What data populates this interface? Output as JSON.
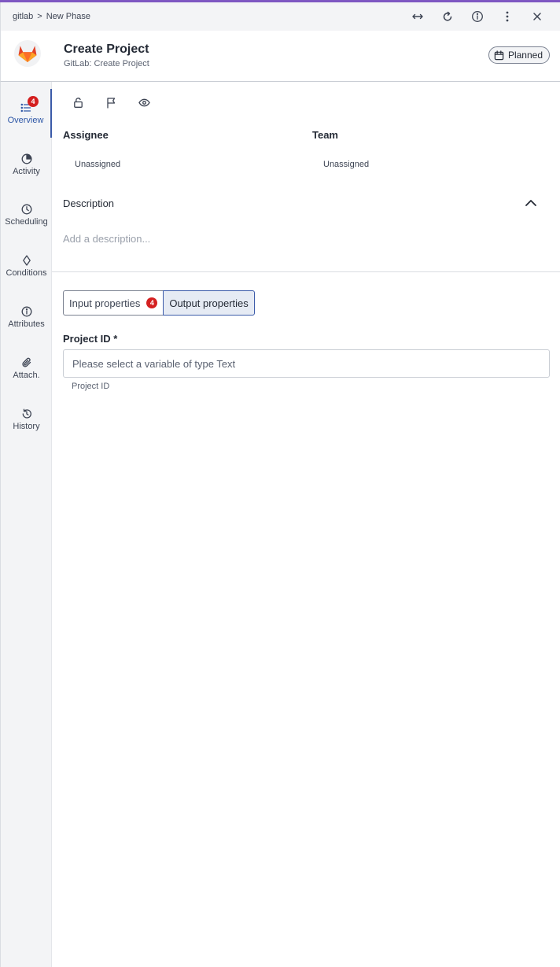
{
  "breadcrumb": {
    "root": "gitlab",
    "separator": ">",
    "current": "New Phase"
  },
  "topbar_icons": [
    "expand-horizontal-icon",
    "refresh-icon",
    "info-icon",
    "more-vertical-icon",
    "close-icon"
  ],
  "header": {
    "title": "Create Project",
    "subtitle": "GitLab: Create Project",
    "status": "Planned"
  },
  "sidebar": {
    "items": [
      {
        "label": "Overview",
        "icon": "list-icon",
        "badge": "4",
        "active": true
      },
      {
        "label": "Activity",
        "icon": "activity-pie-icon"
      },
      {
        "label": "Scheduling",
        "icon": "clock-icon"
      },
      {
        "label": "Conditions",
        "icon": "diamond-icon"
      },
      {
        "label": "Attributes",
        "icon": "info-icon"
      },
      {
        "label": "Attach.",
        "icon": "paperclip-icon"
      },
      {
        "label": "History",
        "icon": "history-icon"
      }
    ]
  },
  "toolbar_icons": [
    "unlock-icon",
    "flag-icon",
    "eye-icon"
  ],
  "assignee": {
    "label": "Assignee",
    "value": "Unassigned"
  },
  "team": {
    "label": "Team",
    "value": "Unassigned"
  },
  "description": {
    "label": "Description",
    "placeholder": "Add a description..."
  },
  "tabs": {
    "input": {
      "label": "Input properties",
      "badge": "4"
    },
    "output": {
      "label": "Output properties"
    }
  },
  "project_id": {
    "label": "Project ID *",
    "placeholder": "Please select a variable of type Text",
    "hint": "Project ID"
  },
  "colors": {
    "accent": "#7e57c2",
    "active": "#3b5ba9",
    "badge": "#d42020"
  }
}
